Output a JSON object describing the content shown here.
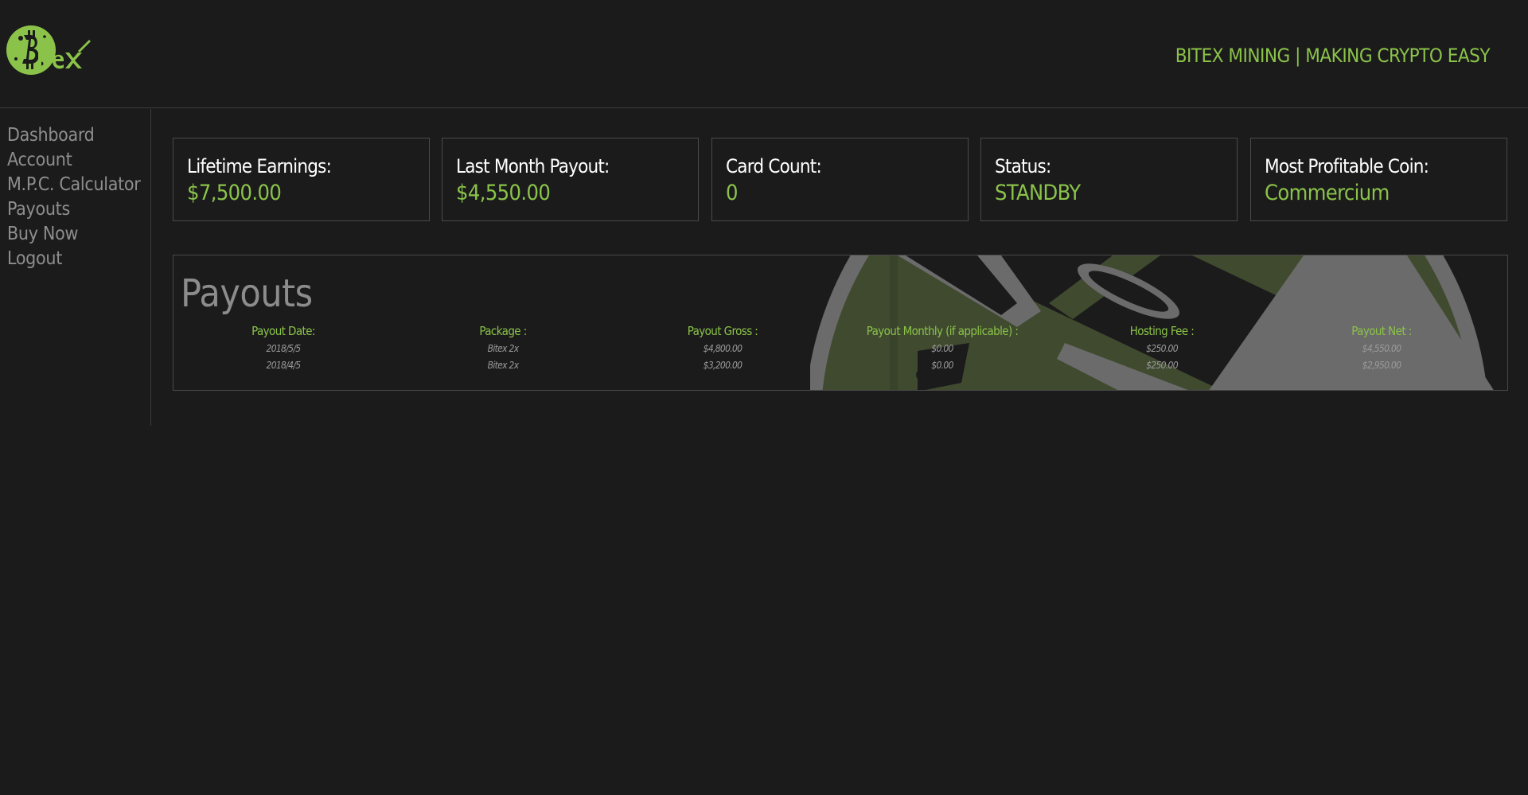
{
  "brand": {
    "tagline": "BITEX MINING | MAKING CRYPTO EASY",
    "accent_color": "#8bc34a",
    "logo_icon": "bitcoin-logo-icon"
  },
  "sidebar": {
    "items": [
      {
        "label": "Dashboard"
      },
      {
        "label": "Account"
      },
      {
        "label": "M.P.C. Calculator"
      },
      {
        "label": "Payouts"
      },
      {
        "label": "Buy Now"
      },
      {
        "label": "Logout"
      }
    ]
  },
  "stats": [
    {
      "label": "Lifetime Earnings:",
      "value": "$7,500.00"
    },
    {
      "label": "Last Month Payout:",
      "value": "$4,550.00"
    },
    {
      "label": "Card Count:",
      "value": "0"
    },
    {
      "label": "Status:",
      "value": "STANDBY"
    },
    {
      "label": "Most Profitable Coin:",
      "value": "Commercium"
    }
  ],
  "payouts": {
    "title": "Payouts",
    "columns": [
      {
        "header": "Payout Date:",
        "rows": [
          "2018/5/5",
          "2018/4/5"
        ]
      },
      {
        "header": "Package :",
        "rows": [
          "Bitex 2x",
          "Bitex 2x"
        ]
      },
      {
        "header": "Payout Gross :",
        "rows": [
          "$4,800.00",
          "$3,200.00"
        ]
      },
      {
        "header": "Payout Monthly (if applicable) :",
        "rows": [
          "$0.00",
          "$0.00"
        ]
      },
      {
        "header": "Hosting Fee :",
        "rows": [
          "$250.00",
          "$250.00"
        ]
      },
      {
        "header": "Payout Net :",
        "rows": [
          "$4,550.00",
          "$2,950.00"
        ]
      }
    ]
  }
}
